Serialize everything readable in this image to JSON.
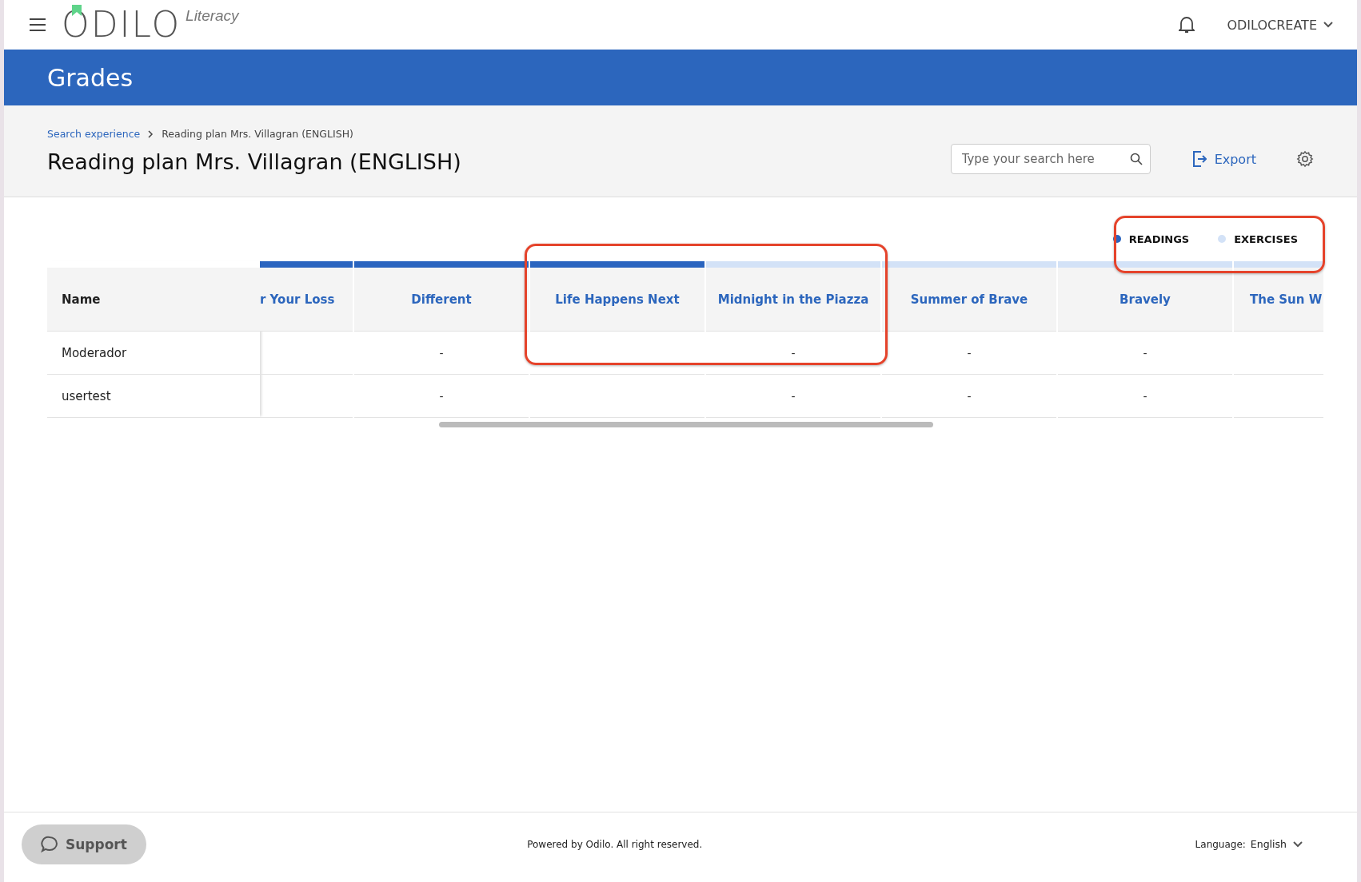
{
  "header": {
    "logo": {
      "name": "ODILO",
      "tagline": "Literacy"
    },
    "user": "ODILOCREATE"
  },
  "banner": {
    "title": "Grades"
  },
  "breadcrumb": [
    {
      "label": "Search experience",
      "kind": "link"
    },
    {
      "label": "Reading plan Mrs. Villagran (ENGLISH)",
      "kind": "text"
    }
  ],
  "page_title": "Reading plan Mrs. Villagran (ENGLISH)",
  "search": {
    "placeholder": "Type your search here"
  },
  "export_label": "Export",
  "legend": [
    {
      "label": "READINGS",
      "color": "#2a64bf"
    },
    {
      "label": "EXERCISES",
      "color": "#d3e2f7"
    }
  ],
  "table": {
    "name_header": "Name",
    "columns": [
      {
        "label": "r Your Loss",
        "kind": "reading"
      },
      {
        "label": "Different",
        "kind": "reading"
      },
      {
        "label": "Life Happens Next",
        "kind": "reading"
      },
      {
        "label": "Midnight in the Piazza",
        "kind": "exercise"
      },
      {
        "label": "Summer of Brave",
        "kind": "exercise"
      },
      {
        "label": "Bravely",
        "kind": "exercise"
      },
      {
        "label": "The Sun W",
        "kind": "exercise"
      }
    ],
    "rows": [
      {
        "name": "Moderador",
        "cells": [
          "",
          "-",
          "",
          "-",
          "-",
          "-",
          ""
        ]
      },
      {
        "name": "usertest",
        "cells": [
          "",
          "-",
          "",
          "-",
          "-",
          "-",
          ""
        ]
      }
    ]
  },
  "footer": {
    "support": "Support",
    "copyright": "Powered by Odilo. All right reserved.",
    "language_label": "Language:",
    "language": "English"
  }
}
